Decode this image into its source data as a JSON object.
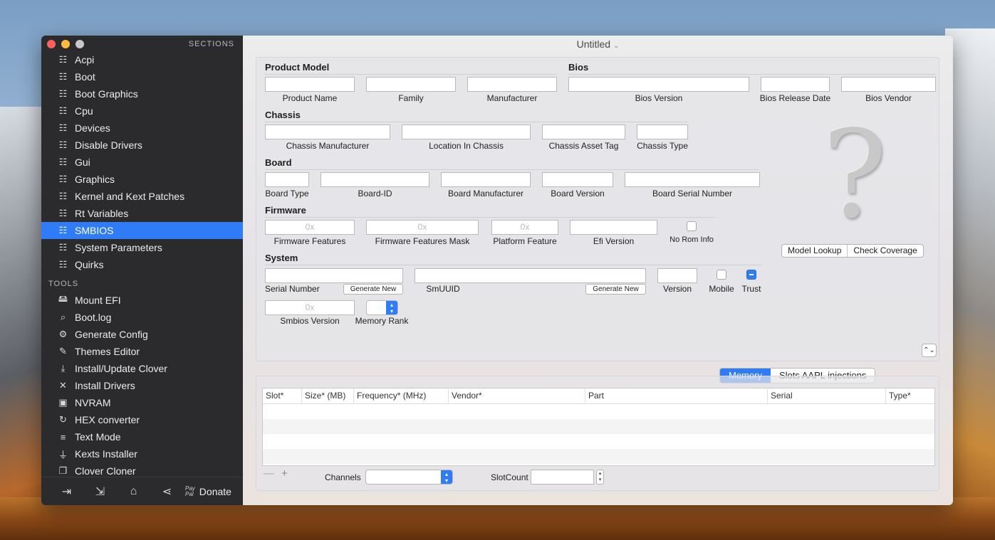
{
  "window": {
    "title": "Untitled",
    "title_chevron": "⌄"
  },
  "sidebar": {
    "sections_title": "SECTIONS",
    "sections": [
      {
        "label": "Acpi"
      },
      {
        "label": "Boot"
      },
      {
        "label": "Boot Graphics"
      },
      {
        "label": "Cpu"
      },
      {
        "label": "Devices"
      },
      {
        "label": "Disable Drivers"
      },
      {
        "label": "Gui"
      },
      {
        "label": "Graphics"
      },
      {
        "label": "Kernel and Kext Patches"
      },
      {
        "label": "Rt Variables"
      },
      {
        "label": "SMBIOS"
      },
      {
        "label": "System Parameters"
      },
      {
        "label": "Quirks"
      }
    ],
    "active_section": "SMBIOS",
    "tools_title": "TOOLS",
    "tools": [
      {
        "label": "Mount EFI",
        "icon": "disk-icon"
      },
      {
        "label": "Boot.log",
        "icon": "log-search-icon"
      },
      {
        "label": "Generate Config",
        "icon": "gears-icon"
      },
      {
        "label": "Themes Editor",
        "icon": "palette-icon"
      },
      {
        "label": "Install/Update Clover",
        "icon": "download-icon"
      },
      {
        "label": "Install Drivers",
        "icon": "tools-icon"
      },
      {
        "label": "NVRAM",
        "icon": "chip-icon"
      },
      {
        "label": "HEX converter",
        "icon": "refresh-icon"
      },
      {
        "label": "Text Mode",
        "icon": "text-icon"
      },
      {
        "label": "Kexts Installer",
        "icon": "plug-icon"
      },
      {
        "label": "Clover Cloner",
        "icon": "copy-icon"
      }
    ],
    "footer": {
      "paypal": "Pay\nPal",
      "donate": "Donate"
    }
  },
  "smbios": {
    "product_model": {
      "title": "Product Model",
      "product_name_label": "Product Name",
      "family_label": "Family",
      "manufacturer_label": "Manufacturer"
    },
    "bios": {
      "title": "Bios",
      "version_label": "Bios Version",
      "release_date_label": "Bios Release Date",
      "vendor_label": "Bios Vendor"
    },
    "chassis": {
      "title": "Chassis",
      "manufacturer_label": "Chassis Manufacturer",
      "location_label": "Location In Chassis",
      "asset_tag_label": "Chassis  Asset Tag",
      "type_label": "Chassis Type"
    },
    "board": {
      "title": "Board",
      "type_label": "Board Type",
      "id_label": "Board-ID",
      "manufacturer_label": "Board Manufacturer",
      "version_label": "Board Version",
      "serial_label": "Board Serial Number"
    },
    "firmware": {
      "title": "Firmware",
      "features_label": "Firmware Features",
      "features_placeholder": "0x",
      "mask_label": "Firmware Features Mask",
      "mask_placeholder": "0x",
      "platform_label": "Platform Feature",
      "platform_placeholder": "0x",
      "efi_label": "Efi Version",
      "no_rom_label": "No Rom Info"
    },
    "system": {
      "title": "System",
      "serial_label": "Serial Number",
      "generate_new_1": "Generate New",
      "smuuid_label": "SmUUID",
      "generate_new_2": "Generate New",
      "version_label": "Version",
      "mobile_label": "Mobile",
      "trust_label": "Trust",
      "trust_checked": true,
      "smbios_version_label": "Smbios Version",
      "smbios_version_placeholder": "0x",
      "memory_rank_label": "Memory Rank"
    },
    "buttons": {
      "model_lookup": "Model Lookup",
      "check_coverage": "Check Coverage"
    },
    "question_mark": "?"
  },
  "memory": {
    "tabs": [
      {
        "label": "Memory",
        "active": true
      },
      {
        "label": "Slots AAPL injections",
        "active": false
      }
    ],
    "columns": [
      "Slot*",
      "Size* (MB)",
      "Frequency* (MHz)",
      "Vendor*",
      "Part",
      "Serial",
      "Type*"
    ],
    "minus": "—",
    "plus": "+",
    "channels_label": "Channels",
    "slotcount_label": "SlotCount"
  }
}
